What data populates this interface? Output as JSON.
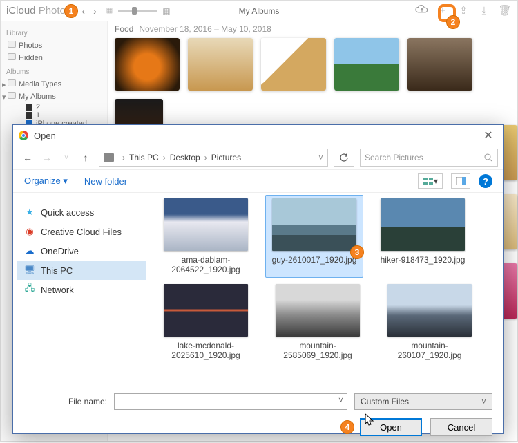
{
  "background": {
    "app_name_bold": "iCloud",
    "app_name_light": " Photos",
    "window_title": "My Albums",
    "sidebar": {
      "library_header": "Library",
      "photos": "Photos",
      "hidden": "Hidden",
      "albums_header": "Albums",
      "media_types": "Media Types",
      "my_albums": "My Albums",
      "sub1": "2",
      "sub2": "1",
      "iphone_album": "iPhone created album"
    },
    "album": {
      "name": "Food",
      "date_range": "November 18, 2016 – May 10, 2018"
    }
  },
  "dialog": {
    "title": "Open",
    "breadcrumbs": [
      "This PC",
      "Desktop",
      "Pictures"
    ],
    "search_placeholder": "Search Pictures",
    "organize": "Organize",
    "new_folder": "New folder",
    "sidebar": {
      "quick_access": "Quick access",
      "creative_cloud": "Creative Cloud Files",
      "onedrive": "OneDrive",
      "this_pc": "This PC",
      "network": "Network"
    },
    "files": [
      {
        "name": "ama-dablam-2064522_1920.jpg"
      },
      {
        "name": "guy-2610017_1920.jpg",
        "selected": true
      },
      {
        "name": "hiker-918473_1920.jpg"
      },
      {
        "name": "lake-mcdonald-2025610_1920.jpg"
      },
      {
        "name": "mountain-2585069_1920.jpg"
      },
      {
        "name": "mountain-260107_1920.jpg"
      }
    ],
    "file_name_label": "File name:",
    "filter": "Custom Files",
    "open_btn": "Open",
    "cancel_btn": "Cancel"
  },
  "annotations": {
    "b1": "1",
    "b2": "2",
    "b3": "3",
    "b4": "4"
  }
}
